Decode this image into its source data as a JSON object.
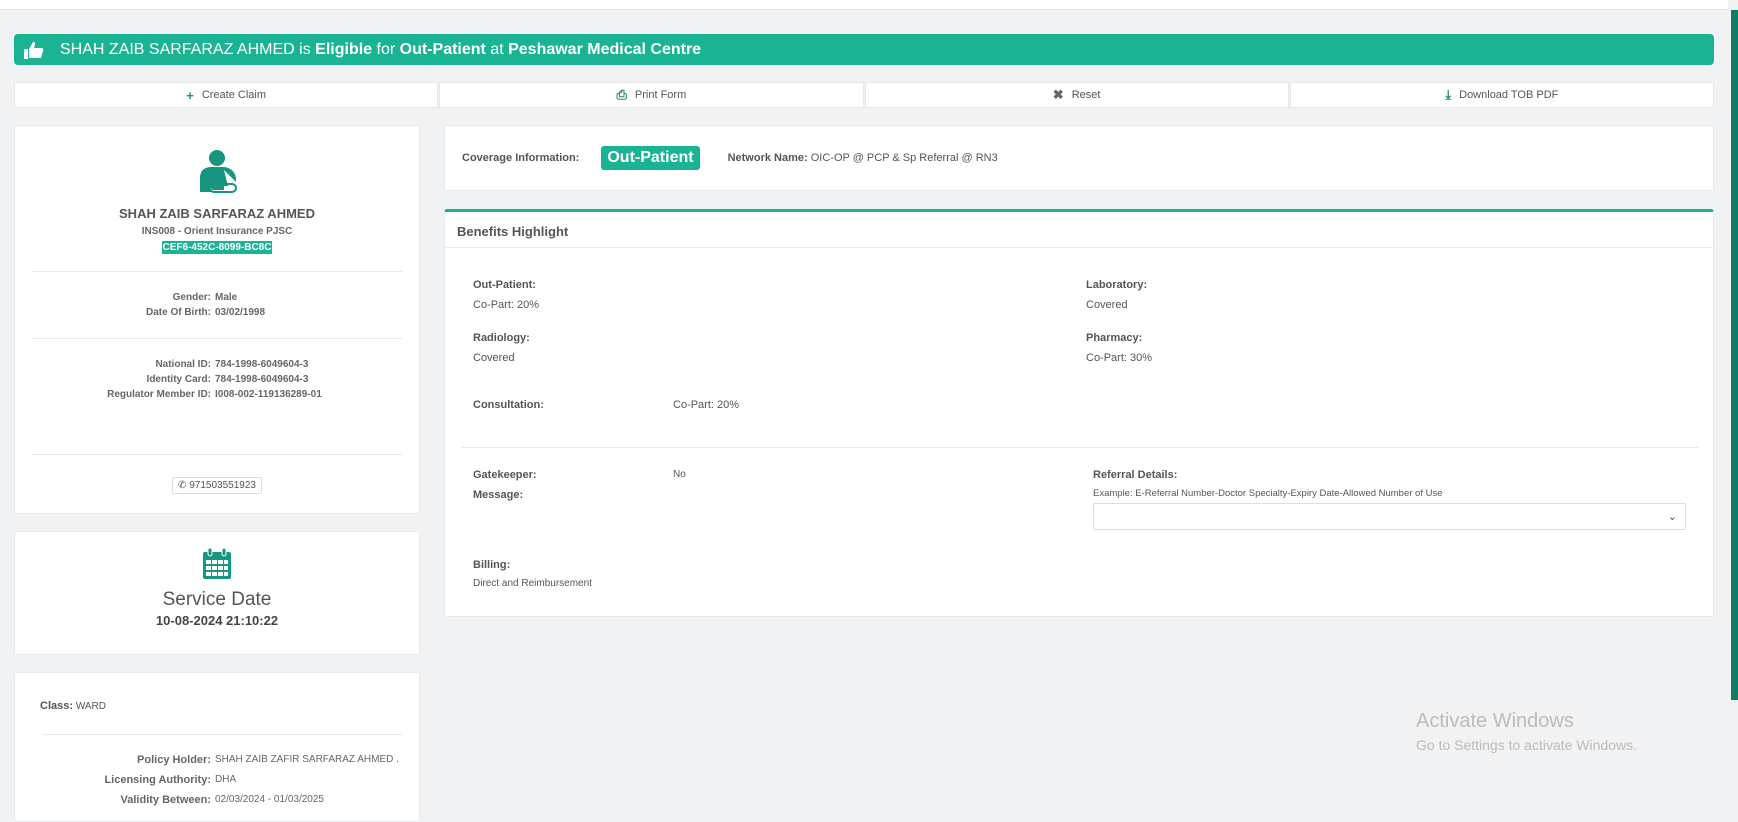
{
  "banner": {
    "name": "SHAH ZAIB SARFARAZ AHMED",
    "is": " is ",
    "status": "Eligible",
    "for": " for ",
    "type": "Out-Patient",
    "at": " at ",
    "facility": "Peshawar Medical Centre",
    "icon": "thumbs-up-icon"
  },
  "toolbar": [
    {
      "label": "Create Claim",
      "icon": "plus-icon",
      "glyph": "+"
    },
    {
      "label": "Print Form",
      "icon": "print-icon",
      "glyph": "⎙"
    },
    {
      "label": "Reset",
      "icon": "close-icon",
      "glyph": "✖"
    },
    {
      "label": "Download TOB PDF",
      "icon": "download-icon",
      "glyph": "⤓"
    }
  ],
  "member": {
    "name": "SHAH ZAIB SARFARAZ AHMED",
    "insurer": "INS008 - Orient Insurance PJSC",
    "card_id": "CEF6-452C-8099-BC8C",
    "gender_label": "Gender:",
    "gender": "Male",
    "dob_label": "Date Of Birth:",
    "dob": "03/02/1998",
    "national_id_label": "National ID:",
    "national_id": "784-1998-6049604-3",
    "identity_card_label": "Identity Card:",
    "identity_card": "784-1998-6049604-3",
    "regulator_label": "Regulator Member ID:",
    "regulator_id": "I008-002-119136289-01",
    "phone": "971503551923"
  },
  "service": {
    "title": "Service Date",
    "value": "10-08-2024 21:10:22"
  },
  "policy": {
    "class_label": "Class:",
    "class": "WARD",
    "holder_label": "Policy Holder:",
    "holder": "SHAH ZAIB ZAFIR SARFARAZ AHMED .",
    "authority_label": "Licensing Authority:",
    "authority": "DHA",
    "validity_label": "Validity Between:",
    "validity": "02/03/2024 - 01/03/2025"
  },
  "coverage": {
    "label": "Coverage Information:",
    "type": "Out-Patient",
    "network_label": "Network Name:",
    "network": "OIC-OP @ PCP & Sp Referral @ RN3"
  },
  "benefits": {
    "title": "Benefits Highlight",
    "outpatient_label": "Out-Patient:",
    "outpatient": "Co-Part: 20%",
    "laboratory_label": "Laboratory:",
    "laboratory": "Covered",
    "radiology_label": "Radiology:",
    "radiology": "Covered",
    "pharmacy_label": "Pharmacy:",
    "pharmacy": "Co-Part: 30%",
    "consultation_label": "Consultation:",
    "consultation": "Co-Part: 20%",
    "gatekeeper_label": "Gatekeeper:",
    "gatekeeper": "No",
    "message_label": "Message:",
    "referral_label": "Referral Details:",
    "referral_hint": "Example: E-Referral Number-Doctor Specialty-Expiry Date-Allowed Number of Use",
    "billing_label": "Billing:",
    "billing": "Direct and Reimbursement"
  },
  "watermark": {
    "line1": "Activate Windows",
    "line2": "Go to Settings to activate Windows."
  },
  "colors": {
    "accent": "#1ab394"
  }
}
